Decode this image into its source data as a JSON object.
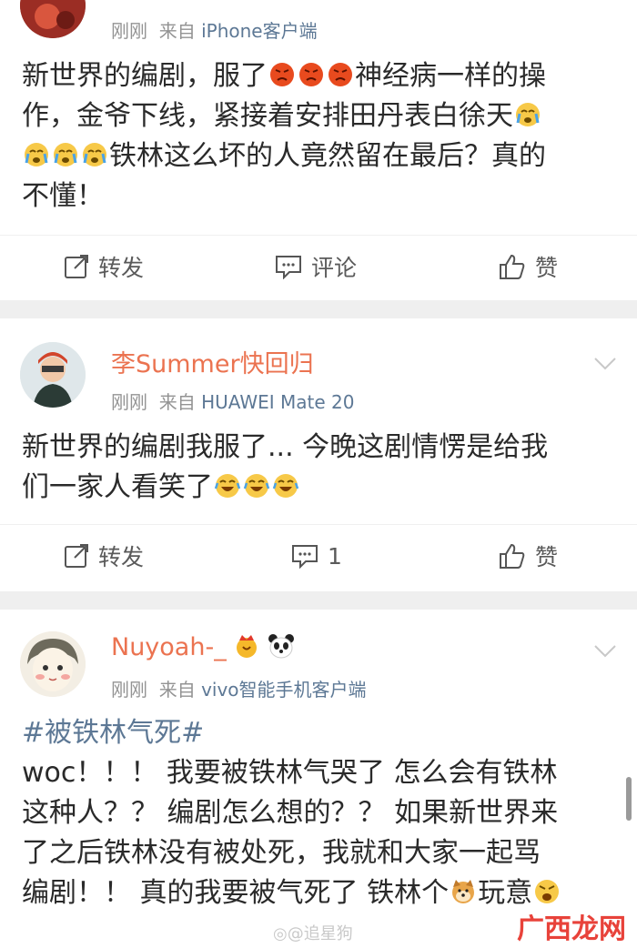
{
  "post1": {
    "meta_time": "刚刚",
    "meta_from": "来自",
    "meta_source": "iPhone客户端",
    "line1a": "新世界的编剧，服了",
    "line1b": "神经病一样的操",
    "line2": "作，金爷下线，紧接着安排田丹表白徐天",
    "line3b": "铁林这么坏的人竟然留在最后？真的",
    "line4": "不懂！"
  },
  "post2": {
    "username": "李Summer快回归",
    "meta_time": "刚刚",
    "meta_from": "来自",
    "meta_source": "HUAWEI Mate 20",
    "line1": "新世界的编剧我服了... 今晚这剧情愣是给我",
    "line2": "们一家人看笑了",
    "comment_count": "1"
  },
  "post3": {
    "username": "Nuyoah-_",
    "meta_time": "刚刚",
    "meta_from": "来自",
    "meta_source": "vivo智能手机客户端",
    "hashtag": "#被铁林气死#",
    "line1": "woc！！！ 我要被铁林气哭了 怎么会有铁林",
    "line2": "这种人？？ 编剧怎么想的？？ 如果新世界来",
    "line3": "了之后铁林没有被处死，我就和大家一起骂",
    "line4a": "编剧！！ 真的我要被气死了 铁林个",
    "line4b": "玩意"
  },
  "actions": {
    "repost": "转发",
    "comment": "评论",
    "like": "赞"
  },
  "watermarks": {
    "weibo": "@追星狗",
    "site": "广西龙网"
  },
  "colors": {
    "username": "#eb7350",
    "source": "#5d7895",
    "meta": "#939393",
    "separator": "#efefef"
  }
}
